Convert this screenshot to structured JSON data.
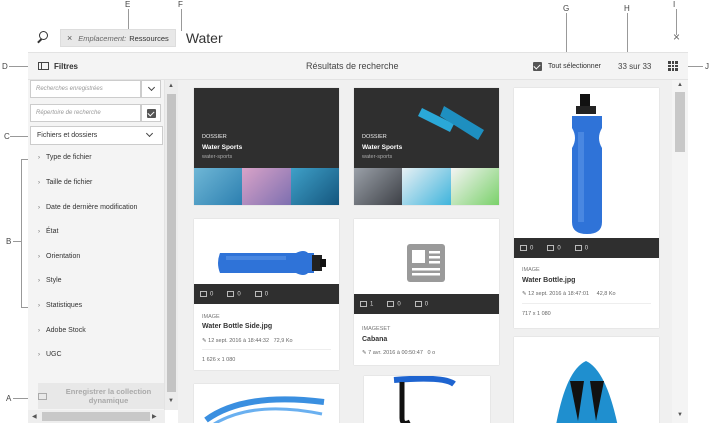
{
  "callouts": {
    "A": "A",
    "B": "B",
    "C": "C",
    "D": "D",
    "E": "E",
    "F": "F",
    "G": "G",
    "H": "H",
    "I": "I",
    "J": "J"
  },
  "search": {
    "tag_key": "Emplacement:",
    "tag_value": "Ressources",
    "query": "Water",
    "close": "×"
  },
  "rail": {
    "filters_label": "Filtres",
    "results_title": "Résultats de recherche",
    "select_all": "Tout sélectionner",
    "count": "33 sur 33"
  },
  "sidebar": {
    "saved_searches_placeholder": "Recherches enregistrées",
    "search_dir_placeholder": "Répertoire de recherche",
    "files_folders": "Fichiers et dossiers",
    "facets": [
      "Type de fichier",
      "Taille de fichier",
      "Date de dernière modification",
      "État",
      "Orientation",
      "Style",
      "Statistiques",
      "Adobe Stock",
      "UGC"
    ],
    "save_collection": "Enregistrer la collection dynamique"
  },
  "cards": {
    "folder1": {
      "type": "DOSSIER",
      "name": "Water Sports",
      "sub": "water-sports"
    },
    "folder2": {
      "type": "DOSSIER",
      "name": "Water Sports",
      "sub": "water-sports"
    },
    "bottle1": {
      "c1": "0",
      "c2": "0",
      "c3": "0",
      "type": "IMAGE",
      "name": "Water Bottle.jpg",
      "date": "12 sept. 2016 à 18:47:01",
      "size": "42,8 Ko",
      "dims": "717 x 1 080"
    },
    "bottle2": {
      "c1": "0",
      "c2": "0",
      "c3": "0",
      "type": "IMAGE",
      "name": "Water Bottle Side.jpg",
      "date": "12 sept. 2016 à 18:44:32",
      "size": "72,9 Ko",
      "dims": "1 626 x 1 080"
    },
    "cabana": {
      "c1": "1",
      "c2": "0",
      "c3": "0",
      "type": "IMAGESET",
      "name": "Cabana",
      "date": "7 avr. 2016 à 00:50:47",
      "size": "0 o"
    }
  },
  "colors": {
    "bottle_blue": "#2f73d8",
    "dark_strip": "#2f2f2f"
  }
}
